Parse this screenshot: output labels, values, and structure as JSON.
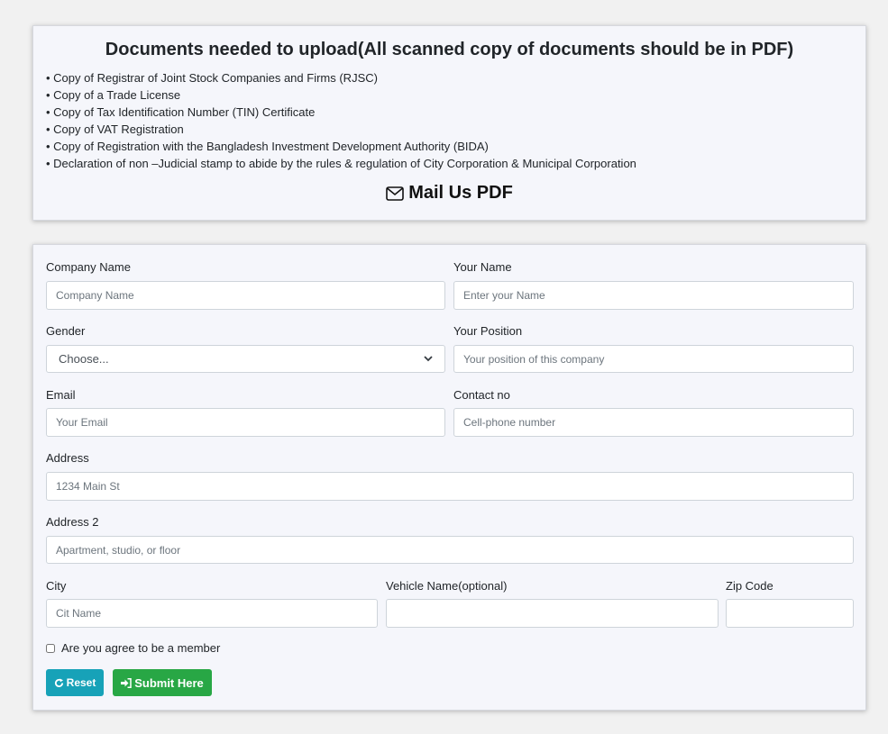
{
  "documents": {
    "title": "Documents needed to upload(All scanned copy of documents should be in PDF)",
    "items": [
      "Copy of Registrar of Joint Stock Companies and Firms (RJSC)",
      "Copy of a Trade License",
      "Copy of Tax Identification Number (TIN) Certificate",
      "Copy of VAT Registration",
      "Copy of Registration with the Bangladesh Investment Development Authority (BIDA)",
      "Declaration of non –Judicial stamp to abide by the rules & regulation of City Corporation & Municipal Corporation"
    ],
    "mail_label": "Mail Us PDF"
  },
  "form": {
    "company_name": {
      "label": "Company Name",
      "placeholder": "Company Name"
    },
    "your_name": {
      "label": "Your Name",
      "placeholder": "Enter your Name"
    },
    "gender": {
      "label": "Gender",
      "value": "Choose..."
    },
    "position": {
      "label": "Your Position",
      "placeholder": "Your position of this company"
    },
    "email": {
      "label": "Email",
      "placeholder": "Your Email"
    },
    "contact": {
      "label": "Contact no",
      "placeholder": "Cell-phone number"
    },
    "address": {
      "label": "Address",
      "placeholder": "1234 Main St"
    },
    "address2": {
      "label": "Address 2",
      "placeholder": "Apartment, studio, or floor"
    },
    "city": {
      "label": "City",
      "placeholder": "Cit Name"
    },
    "vehicle": {
      "label": "Vehicle Name(optional)",
      "placeholder": ""
    },
    "zip": {
      "label": "Zip Code",
      "placeholder": ""
    },
    "member_check": "Are you agree to be a member",
    "reset_label": "Reset",
    "submit_label": "Submit Here"
  },
  "colors": {
    "reset": "#17a2b8",
    "submit": "#28a745"
  }
}
